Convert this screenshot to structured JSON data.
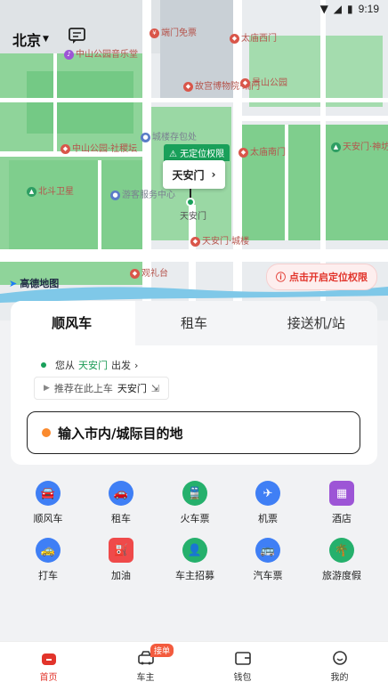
{
  "status_bar": {
    "time": "9:19"
  },
  "header": {
    "city": "北京"
  },
  "map": {
    "pois": [
      {
        "label": "中山公园音乐堂",
        "kind": "purple"
      },
      {
        "label": "端门免票",
        "kind": "red"
      },
      {
        "label": "太庙西门",
        "kind": "red"
      },
      {
        "label": "故宫博物院·端门",
        "kind": "red"
      },
      {
        "label": "景山公园",
        "kind": "red"
      },
      {
        "label": "城楼存包处",
        "kind": "gray"
      },
      {
        "label": "中山公园·社稷坛",
        "kind": "red"
      },
      {
        "label": "太庙南门",
        "kind": "red"
      },
      {
        "label": "天安门·神坊",
        "kind": "green"
      },
      {
        "label": "北斗卫星",
        "kind": "green"
      },
      {
        "label": "游客服务中心",
        "kind": "gray"
      },
      {
        "label": "天安门·城楼",
        "kind": "red"
      },
      {
        "label": "观礼台",
        "kind": "red"
      },
      {
        "label": "天安门",
        "kind": "plain"
      }
    ],
    "location_tag": "无定位权限",
    "location_name": "天安门",
    "map_provider": "高德地图",
    "permission_button": "点击开启定位权限"
  },
  "booking": {
    "tabs": [
      "顺风车",
      "租车",
      "接送机/站"
    ],
    "from_prefix": "您从",
    "from_place": "天安门",
    "from_suffix": "出发",
    "suggest_prefix": "推荐在此上车",
    "suggest_place": "天安门",
    "destination_placeholder": "输入市内/城际目的地"
  },
  "services": [
    {
      "label": "顺风车",
      "icon": "car-share-icon",
      "color": "#3f7ff5"
    },
    {
      "label": "租车",
      "icon": "car-rental-icon",
      "color": "#3f7ff5"
    },
    {
      "label": "火车票",
      "icon": "train-icon",
      "color": "#25b06c"
    },
    {
      "label": "机票",
      "icon": "plane-icon",
      "color": "#3f7ff5"
    },
    {
      "label": "酒店",
      "icon": "hotel-icon",
      "color": "#9d55d6"
    },
    {
      "label": "打车",
      "icon": "taxi-icon",
      "color": "#3f7ff5"
    },
    {
      "label": "加油",
      "icon": "fuel-icon",
      "color": "#ef4a4a"
    },
    {
      "label": "车主招募",
      "icon": "driver-recruit-icon",
      "color": "#25b06c"
    },
    {
      "label": "汽车票",
      "icon": "bus-icon",
      "color": "#3f7ff5"
    },
    {
      "label": "旅游度假",
      "icon": "palm-tree-icon",
      "color": "#25b06c"
    }
  ],
  "bottom_nav": {
    "items": [
      "首页",
      "车主",
      "钱包",
      "我的"
    ],
    "badge": "接单"
  }
}
